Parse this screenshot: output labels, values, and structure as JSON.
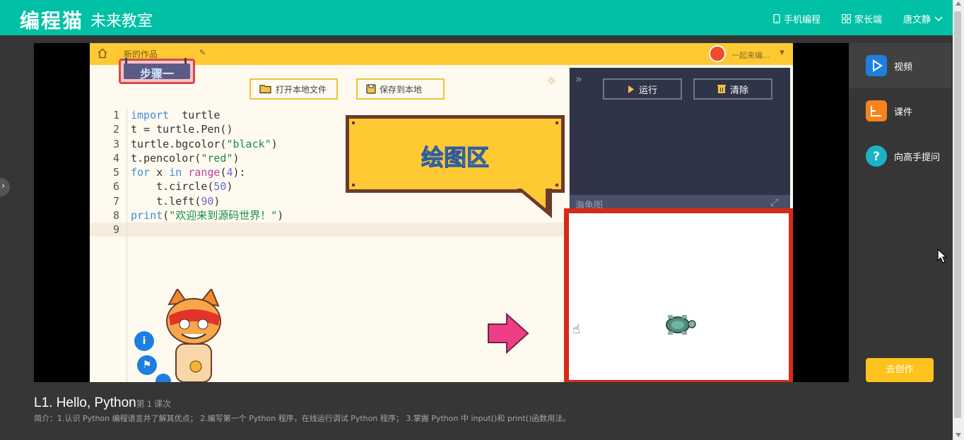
{
  "header": {
    "brand": "编程猫",
    "subtitle": "未来教室",
    "nav_mobile": "手机编程",
    "nav_parent": "家长端",
    "user_name": "唐文静"
  },
  "editor": {
    "tab_label": "新的作品",
    "account_label": "一起来编...",
    "step_sign": "步骤一",
    "open_file": "打开本地文件",
    "save_file": "保存到本地",
    "bubble_text": "绘图区",
    "run_label": "运行",
    "clear_label": "清除",
    "turtle_label": "海龟图",
    "code_lines": [
      {
        "n": "1",
        "parts": [
          [
            "kw",
            "import"
          ],
          [
            "",
            "  turtle"
          ]
        ]
      },
      {
        "n": "2",
        "parts": [
          [
            "",
            "t = turtle.Pen()"
          ]
        ]
      },
      {
        "n": "3",
        "parts": [
          [
            "",
            "turtle.bgcolor("
          ],
          [
            "str",
            "\"black\""
          ],
          [
            "",
            ")"
          ]
        ]
      },
      {
        "n": "4",
        "parts": [
          [
            "",
            "t.pencolor("
          ],
          [
            "str",
            "\"red\""
          ],
          [
            "",
            ")"
          ]
        ]
      },
      {
        "n": "5",
        "parts": [
          [
            "kw",
            "for"
          ],
          [
            "",
            " x "
          ],
          [
            "kw",
            "in"
          ],
          [
            "",
            " "
          ],
          [
            "fn",
            "range"
          ],
          [
            "",
            "("
          ],
          [
            "num",
            "4"
          ],
          [
            "",
            "):"
          ]
        ]
      },
      {
        "n": "6",
        "parts": [
          [
            "",
            "    t.circle("
          ],
          [
            "num",
            "50"
          ],
          [
            "",
            ")"
          ]
        ]
      },
      {
        "n": "7",
        "parts": [
          [
            "",
            "    t.left("
          ],
          [
            "num",
            "90"
          ],
          [
            "",
            ")"
          ]
        ]
      },
      {
        "n": "8",
        "parts": [
          [
            "kw",
            "print"
          ],
          [
            "",
            "("
          ],
          [
            "str",
            "\"欢迎来到源码世界！\""
          ],
          [
            "",
            ")"
          ]
        ]
      },
      {
        "n": "9",
        "parts": [
          [
            "",
            ""
          ]
        ]
      }
    ]
  },
  "side_panel": {
    "video": "视频",
    "courseware": "课件",
    "ask": "向高手提问",
    "create": "去创作"
  },
  "lesson": {
    "title": "L1. Hello, Python",
    "meta": "第 1 课次",
    "desc": "简介：1.认识 Python 编程语言并了解其优点； 2.编写第一个 Python 程序，在线运行调试 Python 程序； 3.掌握 Python 中 input()和 print()函数用法。"
  },
  "colors": {
    "topbar": "#00c1a6",
    "accent_yellow": "#ffc21e",
    "canvas_border": "#d62a18"
  }
}
